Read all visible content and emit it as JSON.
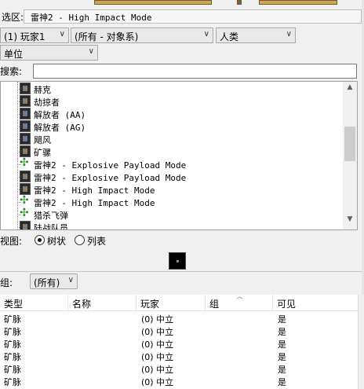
{
  "selection": {
    "label": "选区:",
    "value": "雷神2 - High Impact Mode"
  },
  "filters": {
    "player": "(1) 玩家1",
    "scope": "(所有 - 对象系)",
    "race": "人类",
    "category": "单位"
  },
  "search": {
    "label": "搜索:",
    "value": ""
  },
  "tree": {
    "items": [
      {
        "label": "赫克",
        "icon": "dark-unit-icon"
      },
      {
        "label": "劫掠者",
        "icon": "dark-unit-icon"
      },
      {
        "label": "解放者 (AA)",
        "icon": "mech-unit-icon"
      },
      {
        "label": "解放者 (AG)",
        "icon": "mech-unit-icon"
      },
      {
        "label": "飓风",
        "icon": "mech-unit-icon"
      },
      {
        "label": "矿骡",
        "icon": "dark-unit-icon"
      },
      {
        "label": "雷神2 - Explosive Payload Mode",
        "icon": "green-unit-icon"
      },
      {
        "label": "雷神2 - Explosive Payload Mode",
        "icon": "dark-unit-icon"
      },
      {
        "label": "雷神2 - High Impact Mode",
        "icon": "dark-unit-icon"
      },
      {
        "label": "雷神2 - High Impact Mode",
        "icon": "green-unit-icon"
      },
      {
        "label": "猎杀飞弹",
        "icon": "green-unit-icon"
      },
      {
        "label": "陆战队员",
        "icon": "dark-unit-icon"
      }
    ]
  },
  "view": {
    "label": "视图:",
    "options": [
      "树状",
      "列表"
    ],
    "selected": "树状"
  },
  "group": {
    "label": "组:",
    "value": "(所有)"
  },
  "table": {
    "columns": [
      "类型",
      "名称",
      "玩家",
      "组",
      "可见"
    ],
    "rows": [
      [
        "矿脉",
        "",
        "(0) 中立",
        "",
        "是"
      ],
      [
        "矿脉",
        "",
        "(0) 中立",
        "",
        "是"
      ],
      [
        "矿脉",
        "",
        "(0) 中立",
        "",
        "是"
      ],
      [
        "矿脉",
        "",
        "(0) 中立",
        "",
        "是"
      ],
      [
        "矿脉",
        "",
        "(0) 中立",
        "",
        "是"
      ],
      [
        "矿脉",
        "",
        "(0) 中立",
        "",
        "是"
      ]
    ]
  }
}
